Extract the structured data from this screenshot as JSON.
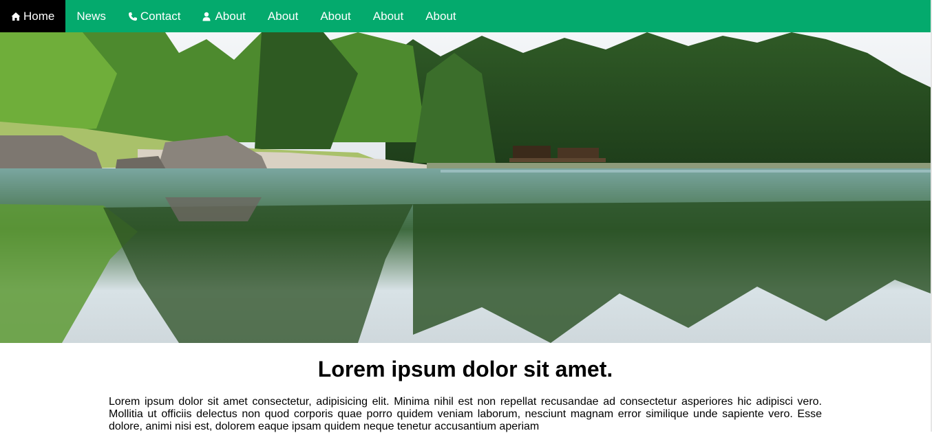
{
  "nav": {
    "items": [
      {
        "label": "Home",
        "icon": "home-icon",
        "active": true
      },
      {
        "label": "News",
        "icon": null,
        "active": false
      },
      {
        "label": "Contact",
        "icon": "phone-icon",
        "active": false
      },
      {
        "label": "About",
        "icon": "user-icon",
        "active": false
      },
      {
        "label": "About",
        "icon": null,
        "active": false
      },
      {
        "label": "About",
        "icon": null,
        "active": false
      },
      {
        "label": "About",
        "icon": null,
        "active": false
      },
      {
        "label": "About",
        "icon": null,
        "active": false
      }
    ]
  },
  "hero": {
    "image": "lake-forest-reflection-image"
  },
  "article": {
    "title": "Lorem ipsum dolor sit amet.",
    "body": "Lorem ipsum dolor sit amet consectetur, adipisicing elit. Minima nihil est non repellat recusandae ad consectetur asperiores hic adipisci vero. Mollitia ut officiis delectus non quod corporis quae porro quidem veniam laborum, nesciunt magnam error similique unde sapiente vero. Esse dolore, animi nisi est, dolorem eaque ipsam quidem neque tenetur accusantium aperiam"
  },
  "colors": {
    "nav_background": "#04aa6d",
    "nav_active_background": "#000000",
    "nav_text": "#ffffff"
  }
}
